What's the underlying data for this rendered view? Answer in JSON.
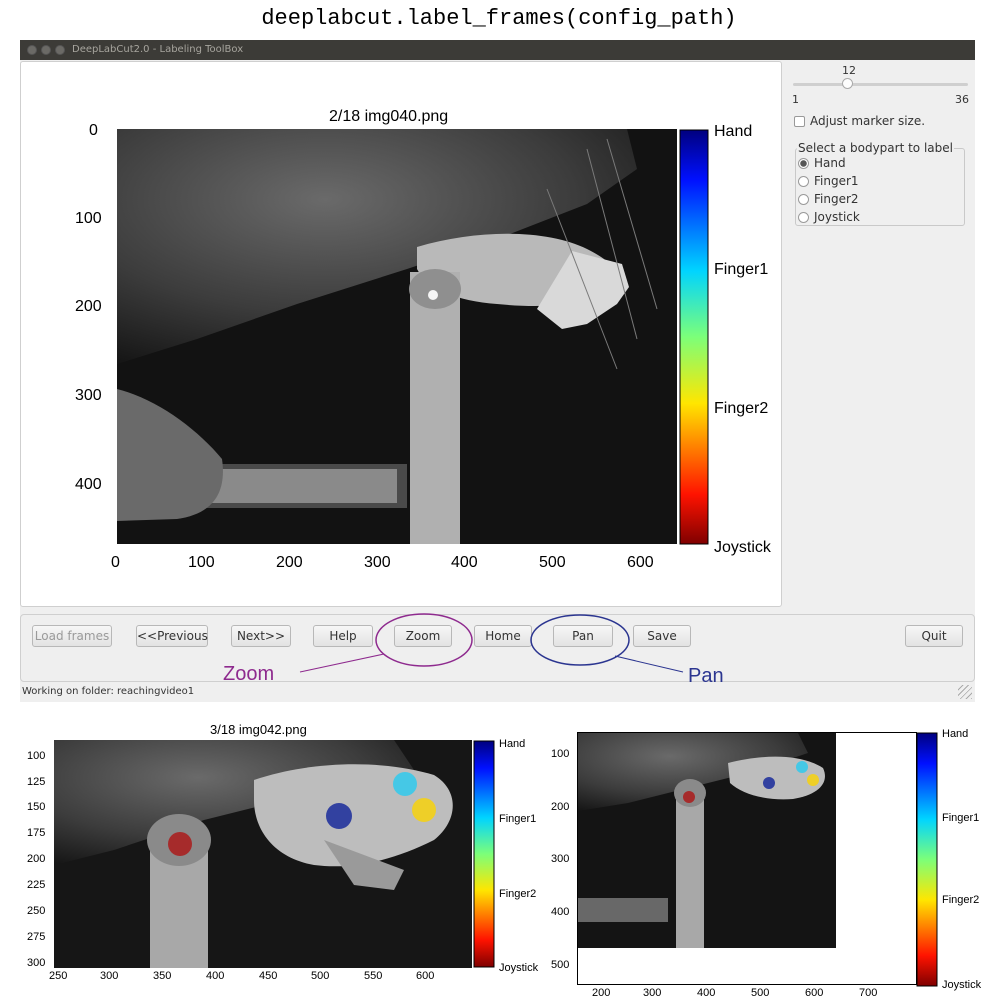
{
  "page_title": "deeplabcut.label_frames(config_path)",
  "window": {
    "title": "DeepLabCut2.0 - Labeling ToolBox",
    "main_plot": {
      "title": "2/18 img040.png",
      "y_ticks": [
        "0",
        "100",
        "200",
        "300",
        "400"
      ],
      "x_ticks": [
        "0",
        "100",
        "200",
        "300",
        "400",
        "500",
        "600"
      ],
      "colorbar_labels": [
        "Hand",
        "Finger1",
        "Finger2",
        "Joystick"
      ]
    },
    "slider": {
      "value": "12",
      "min": "1",
      "max": "36",
      "level_fraction": 0.314
    },
    "adjust_marker_label": "Adjust marker size.",
    "bodypart_group": {
      "legend": "Select a bodypart to label",
      "options": [
        "Hand",
        "Finger1",
        "Finger2",
        "Joystick"
      ],
      "selected": "Hand"
    },
    "buttons": {
      "load_frames": "Load frames",
      "previous": "<<Previous",
      "next": "Next>>",
      "help": "Help",
      "zoom": "Zoom",
      "home": "Home",
      "pan": "Pan",
      "save": "Save",
      "quit": "Quit"
    },
    "status": "Working on folder: reachingvideo1"
  },
  "annotations": {
    "zoom_label": "Zoom",
    "pan_label": "Pan",
    "zoom_color": "#8e2a8e",
    "pan_color": "#2b3590"
  },
  "zoom_plot": {
    "title": "3/18 img042.png",
    "y_ticks": [
      "100",
      "125",
      "150",
      "175",
      "200",
      "225",
      "250",
      "275",
      "300"
    ],
    "x_ticks": [
      "250",
      "300",
      "350",
      "400",
      "450",
      "500",
      "550",
      "600"
    ],
    "colorbar_labels": [
      "Hand",
      "Finger1",
      "Finger2",
      "Joystick"
    ]
  },
  "pan_plot": {
    "y_ticks": [
      "100",
      "200",
      "300",
      "400",
      "500"
    ],
    "x_ticks": [
      "200",
      "300",
      "400",
      "500",
      "600",
      "700"
    ],
    "colorbar_labels": [
      "Hand",
      "Finger1",
      "Finger2",
      "Joystick"
    ]
  },
  "markers": {
    "hand_color": "#2a3a9e",
    "finger1_color": "#3ec8e8",
    "finger2_color": "#f0d020",
    "joystick_color": "#a82020"
  }
}
